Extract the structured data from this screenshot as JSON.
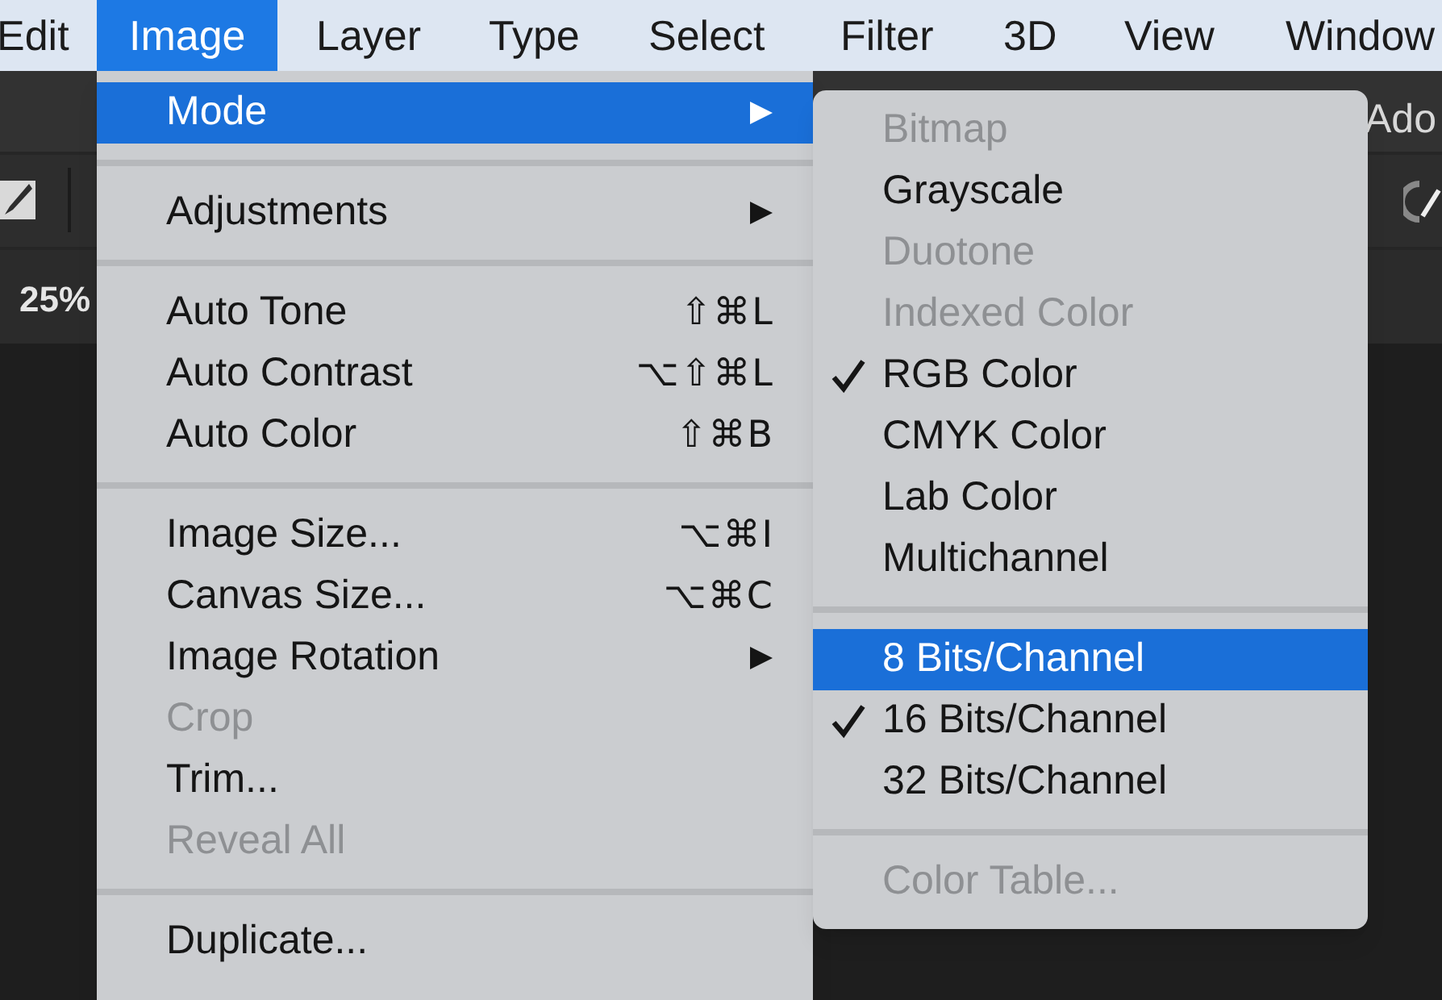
{
  "menu_bar": [
    {
      "label": "Edit",
      "selected": false
    },
    {
      "label": "Image",
      "selected": true
    },
    {
      "label": "Layer",
      "selected": false
    },
    {
      "label": "Type",
      "selected": false
    },
    {
      "label": "Select",
      "selected": false
    },
    {
      "label": "Filter",
      "selected": false
    },
    {
      "label": "3D",
      "selected": false
    },
    {
      "label": "View",
      "selected": false
    },
    {
      "label": "Window",
      "selected": false
    }
  ],
  "app": {
    "title": "Ado",
    "zoom_label": "25%"
  },
  "image_menu": [
    {
      "kind": "item",
      "label": "Mode",
      "has_submenu": true,
      "selected": true,
      "disabled": false
    },
    {
      "kind": "separator"
    },
    {
      "kind": "item",
      "label": "Adjustments",
      "has_submenu": true,
      "selected": false,
      "disabled": false
    },
    {
      "kind": "separator"
    },
    {
      "kind": "item",
      "label": "Auto Tone",
      "shortcut": "⇧⌘L",
      "selected": false,
      "disabled": false
    },
    {
      "kind": "item",
      "label": "Auto Contrast",
      "shortcut": "⌥⇧⌘L",
      "selected": false,
      "disabled": false
    },
    {
      "kind": "item",
      "label": "Auto Color",
      "shortcut": "⇧⌘B",
      "selected": false,
      "disabled": false
    },
    {
      "kind": "separator"
    },
    {
      "kind": "item",
      "label": "Image Size...",
      "shortcut": "⌥⌘I",
      "selected": false,
      "disabled": false
    },
    {
      "kind": "item",
      "label": "Canvas Size...",
      "shortcut": "⌥⌘C",
      "selected": false,
      "disabled": false
    },
    {
      "kind": "item",
      "label": "Image Rotation",
      "has_submenu": true,
      "selected": false,
      "disabled": false
    },
    {
      "kind": "item",
      "label": "Crop",
      "selected": false,
      "disabled": true
    },
    {
      "kind": "item",
      "label": "Trim...",
      "selected": false,
      "disabled": false
    },
    {
      "kind": "item",
      "label": "Reveal All",
      "selected": false,
      "disabled": true
    },
    {
      "kind": "separator"
    },
    {
      "kind": "item",
      "label": "Duplicate...",
      "selected": false,
      "disabled": false
    }
  ],
  "mode_submenu": [
    {
      "kind": "item",
      "label": "Bitmap",
      "checked": false,
      "selected": false,
      "disabled": true
    },
    {
      "kind": "item",
      "label": "Grayscale",
      "checked": false,
      "selected": false,
      "disabled": false
    },
    {
      "kind": "item",
      "label": "Duotone",
      "checked": false,
      "selected": false,
      "disabled": true
    },
    {
      "kind": "item",
      "label": "Indexed Color",
      "checked": false,
      "selected": false,
      "disabled": true
    },
    {
      "kind": "item",
      "label": "RGB Color",
      "checked": true,
      "selected": false,
      "disabled": false
    },
    {
      "kind": "item",
      "label": "CMYK Color",
      "checked": false,
      "selected": false,
      "disabled": false
    },
    {
      "kind": "item",
      "label": "Lab Color",
      "checked": false,
      "selected": false,
      "disabled": false
    },
    {
      "kind": "item",
      "label": "Multichannel",
      "checked": false,
      "selected": false,
      "disabled": false
    },
    {
      "kind": "separator"
    },
    {
      "kind": "item",
      "label": "8 Bits/Channel",
      "checked": false,
      "selected": true,
      "disabled": false
    },
    {
      "kind": "item",
      "label": "16 Bits/Channel",
      "checked": true,
      "selected": false,
      "disabled": false
    },
    {
      "kind": "item",
      "label": "32 Bits/Channel",
      "checked": false,
      "selected": false,
      "disabled": false
    },
    {
      "kind": "separator"
    },
    {
      "kind": "item",
      "label": "Color Table...",
      "checked": false,
      "selected": false,
      "disabled": true
    }
  ]
}
